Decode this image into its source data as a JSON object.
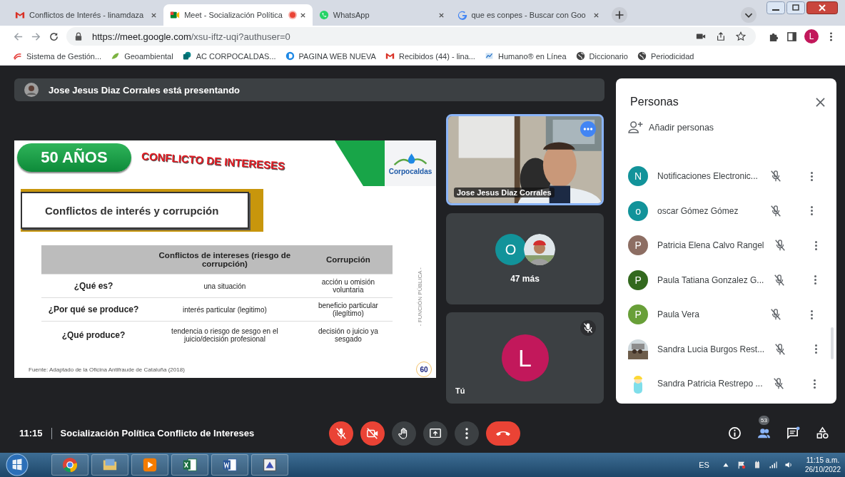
{
  "browser": {
    "tabs": [
      {
        "title": "Conflictos de Interés - linamdaza",
        "selected": false,
        "recording": false
      },
      {
        "title": "Meet - Socialización Política",
        "selected": true,
        "recording": true
      },
      {
        "title": "WhatsApp",
        "selected": false,
        "recording": false
      },
      {
        "title": "que es conpes - Buscar con Goo",
        "selected": false,
        "recording": false
      }
    ],
    "url_host": "https://meet.google.com",
    "url_path": "/xsu-iftz-uqi?authuser=0",
    "profile": "L",
    "bookmarks": [
      {
        "label": "Sistema de Gestión..."
      },
      {
        "label": "Geoambiental"
      },
      {
        "label": "AC CORPOCALDAS..."
      },
      {
        "label": "PAGINA WEB NUEVA"
      },
      {
        "label": "Recibidos (44) - lina..."
      },
      {
        "label": "Humano® en Línea"
      },
      {
        "label": "Diccionario"
      },
      {
        "label": "Periodicidad"
      }
    ]
  },
  "meet": {
    "presenter_banner": "Jose Jesus Diaz Corrales está presentando",
    "slide": {
      "badge": "50 AÑOS",
      "title": "CONFLICTO DE INTERESES",
      "logo": "Corpocaldas",
      "heading": "Conflictos de interés y corrupción",
      "columns": [
        "Conflictos de intereses (riesgo de corrupción)",
        "Corrupción"
      ],
      "rows": [
        {
          "label": "¿Qué es?",
          "cells": [
            "una situación",
            "acción u omisión voluntaria"
          ]
        },
        {
          "label": "¿Por qué se produce?",
          "cells": [
            "interés particular (legitimo)",
            "beneficio particular (ilegítimo)"
          ]
        },
        {
          "label": "¿Qué produce?",
          "cells": [
            "tendencia o riesgo de sesgo en el juicio/decisión profesional",
            "decisión o juicio ya sesgado"
          ]
        }
      ],
      "side_text": "- FUNCIÓN PÚBLICA -",
      "source": "Fuente: Adaptado de la Oficina Antifraude de Cataluña (2018)",
      "corner_logo": "60"
    },
    "tiles": [
      {
        "kind": "video",
        "name": "Jose Jesus Diaz Corrales",
        "selected": true
      },
      {
        "kind": "group",
        "initial": "O",
        "color": "#12939a",
        "more": "47 más",
        "selected": false
      },
      {
        "kind": "self",
        "initial": "L",
        "color": "#c2185b",
        "label": "Tú",
        "muted": true,
        "selected": false
      }
    ],
    "people": {
      "title": "Personas",
      "add": "Añadir personas",
      "list": [
        {
          "name": "Notificaciones Electronic...",
          "kind": "letter",
          "initial": "N",
          "color": "#12939a"
        },
        {
          "name": "oscar Gómez Gómez",
          "kind": "letter",
          "initial": "o",
          "color": "#12939a"
        },
        {
          "name": "Patricia Elena Calvo Rangel",
          "kind": "letter",
          "initial": "P",
          "color": "#8d6e63"
        },
        {
          "name": "Paula Tatiana Gonzalez G...",
          "kind": "letter",
          "initial": "P",
          "color": "#33691e"
        },
        {
          "name": "Paula Vera",
          "kind": "letter",
          "initial": "P",
          "color": "#689f38"
        },
        {
          "name": "Sandra Lucia Burgos Rest..."
        },
        {
          "name": "Sandra Patricia Restrepo ...",
          "kind": "cartoon"
        }
      ]
    },
    "bar": {
      "time": "11:15",
      "title": "Socialización Política Conflicto de Intereses",
      "controls": [
        {
          "kind": "mic",
          "off": true
        },
        {
          "kind": "camera",
          "off": true
        },
        {
          "kind": "hand",
          "off": false
        },
        {
          "kind": "present",
          "off": false
        },
        {
          "kind": "more",
          "off": false
        },
        {
          "kind": "leave",
          "off": false
        }
      ],
      "people_count": "53"
    }
  },
  "taskbar": {
    "language": "ES",
    "time": "11:15 a.m.",
    "date": "26/10/2022"
  }
}
